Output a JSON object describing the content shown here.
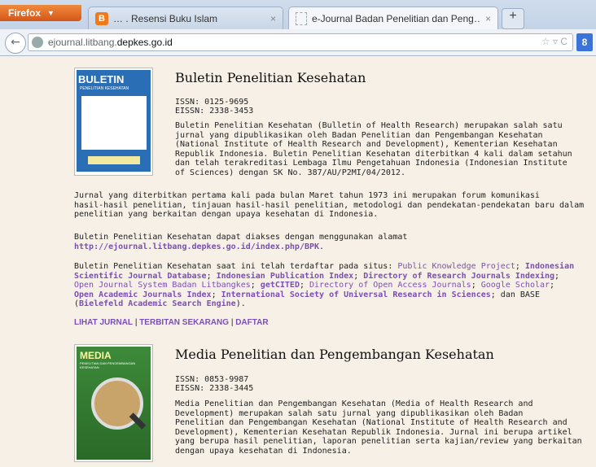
{
  "browser": {
    "app_button": "Firefox",
    "tabs": [
      {
        "title": "… . Resensi Buku Islam",
        "close": "×"
      },
      {
        "title": "e-Journal Badan Penelitian dan Peng…",
        "close": "×"
      }
    ],
    "new_tab": "+",
    "url_dim": "ejournal.litbang.",
    "url_bold": "depkes.go.id",
    "url_icons": "☆ ▿ C",
    "search_btn": "8"
  },
  "journals": [
    {
      "title": "Buletin Penelitian Kesehatan",
      "cover_label": "BULETIN",
      "cover_sub": "PENELITIAN KESEHATAN",
      "issn": "ISSN: 0125-9695",
      "eissn": "EISSN: 2338-3453",
      "desc": [
        "Buletin Penelitian Kesehatan (Bulletin of Health Research) merupakan salah satu",
        "jurnal yang dipublikasikan oleh Badan Penelitian dan Pengembangan Kesehatan",
        "(National Institute of Health Research and Development), Kementerian Kesehatan",
        "Republik Indonesia. Buletin Penelitian Kesehatan diterbitkan 4 kali dalam setahun",
        "dan telah terakreditasi Lembaga Ilmu Pengetahuan Indonesia (Indonesian Institute",
        "of Sciences) dengan SK No. 387/AU/P2MI/04/2012."
      ],
      "para2": [
        "Jurnal yang diterbitkan pertama kali pada bulan Maret tahun 1973 ini merupakan forum komunikasi",
        "hasil-hasil penelitian, tinjauan hasil-hasil penelitian, metodologi dan pendekatan-pendekatan baru dalam",
        "penelitian yang berkaitan dengan upaya kesehatan di Indonesia."
      ],
      "access_text": "Buletin Penelitian Kesehatan dapat diakses dengan menggunakan alamat",
      "access_url": "http://ejournal.litbang.depkes.go.id/index.php/BPK",
      "index_intro": "Buletin Penelitian Kesehatan saat ini telah terdaftar pada situs: ",
      "indexes": {
        "pkp": "Public Knowledge Project",
        "isjd": "Indonesian",
        "isjd2": "Scientific Journal Database",
        "ipi": "Indonesian Publication Index",
        "drji": "Directory of Research Journals Indexing",
        "ojs": "Open Journal System Badan Litbangkes",
        "getcited": "getCITED",
        "doaj": "Directory of Open Access Journals",
        "gscholar": "Google Scholar",
        "oaji": "Open Academic Journals Index",
        "isurs": "International Society of Universal Research in Sciences",
        "base_pre": "; dan BASE",
        "base": "Bielefeld Academic Search Engine"
      },
      "menu": [
        "LIHAT JURNAL",
        "TERBITAN SEKARANG",
        "DAFTAR"
      ]
    },
    {
      "title": "Media Penelitian dan Pengembangan Kesehatan",
      "cover_label": "MEDIA",
      "cover_sub": "PENELITIAN DAN PENGEMBANGAN KESEHATAN",
      "issn": "ISSN: 0853-9987",
      "eissn": "EISSN: 2338-3445",
      "desc": [
        "Media Penelitian dan Pengembangan Kesehatan (Media of Health Research and",
        "Development) merupakan salah satu jurnal yang dipublikasikan oleh  Badan",
        "Penelitian dan Pengembangan Kesehatan (National Institute of Health Research and",
        "Development), Kementerian Kesehatan Republik Indonesia. Jurnal ini berupa artikel",
        "yang berupa hasil penelitian, laporan penelitian serta  kajian/review yang berkaitan",
        "dengan upaya kesehatan di Indonesia."
      ]
    }
  ]
}
